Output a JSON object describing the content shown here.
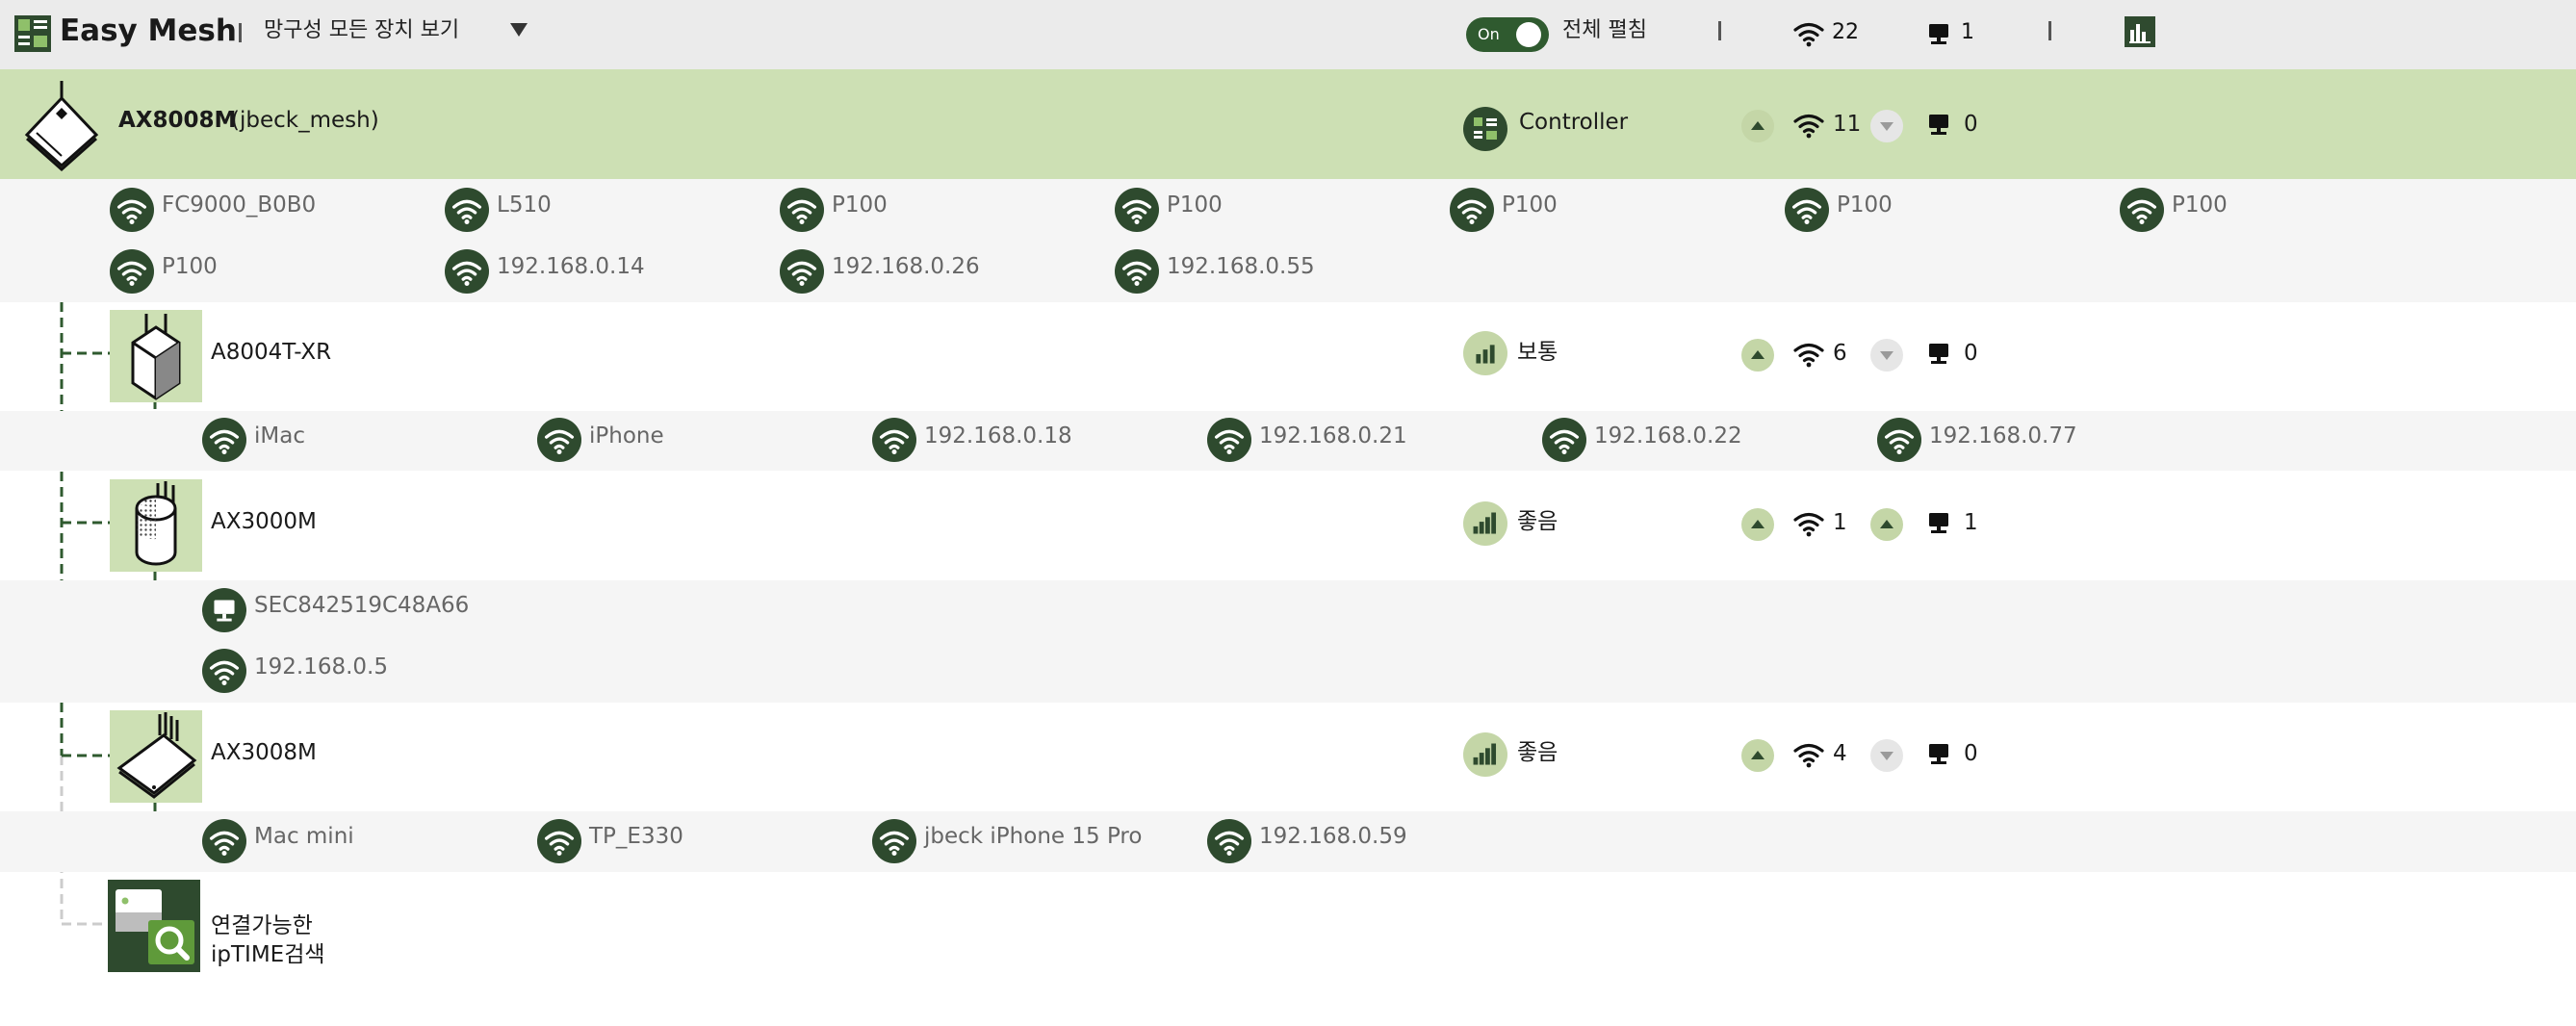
{
  "header": {
    "title": "Easy Mesh",
    "view_label": "망구성 모든 장치 보기",
    "toggle_label": "On",
    "expand_label": "전체 펼침",
    "wifi_total": "22",
    "wired_total": "1"
  },
  "root": {
    "model": "AX8008M",
    "name": "(jbeck_mesh)",
    "role": "Controller",
    "wifi": "11",
    "wired": "0",
    "clients_row1": [
      "FC9000_B0B0",
      "L510",
      "P100",
      "P100",
      "P100",
      "P100",
      "P100"
    ],
    "clients_row2": [
      "P100",
      "192.168.0.14",
      "192.168.0.26",
      "192.168.0.55"
    ]
  },
  "nodes": [
    {
      "model": "A8004T-XR",
      "status": "보통",
      "wifi": "6",
      "wired": "0",
      "clients": [
        "iMac",
        "iPhone",
        "192.168.0.18",
        "192.168.0.21",
        "192.168.0.22",
        "192.168.0.77"
      ]
    },
    {
      "model": "AX3000M",
      "status": "좋음",
      "wifi": "1",
      "wired": "1",
      "wired_clients": [
        "SEC842519C48A66"
      ],
      "clients": [
        "192.168.0.5"
      ]
    },
    {
      "model": "AX3008M",
      "status": "좋음",
      "wifi": "4",
      "wired": "0",
      "clients": [
        "Mac mini",
        "TP_E330",
        "jbeck iPhone 15 Pro",
        "192.168.0.59"
      ]
    }
  ],
  "scan": {
    "line1": "연결가능한",
    "line2": "ipTIME검색"
  },
  "colors": {
    "accent_dark": "#2e4a2e",
    "accent_light": "#cde0b4",
    "signal_badge": "#c4d6a7",
    "tree_line": "#2f5a2f"
  },
  "icons": {
    "wifi": "wifi-icon",
    "wired": "wired-monitor-icon",
    "up": "arrow-up-icon",
    "down": "arrow-down-icon",
    "signal": "signal-bars-icon",
    "controller": "controller-icon",
    "stats": "statistics-icon",
    "search": "search-icon"
  }
}
